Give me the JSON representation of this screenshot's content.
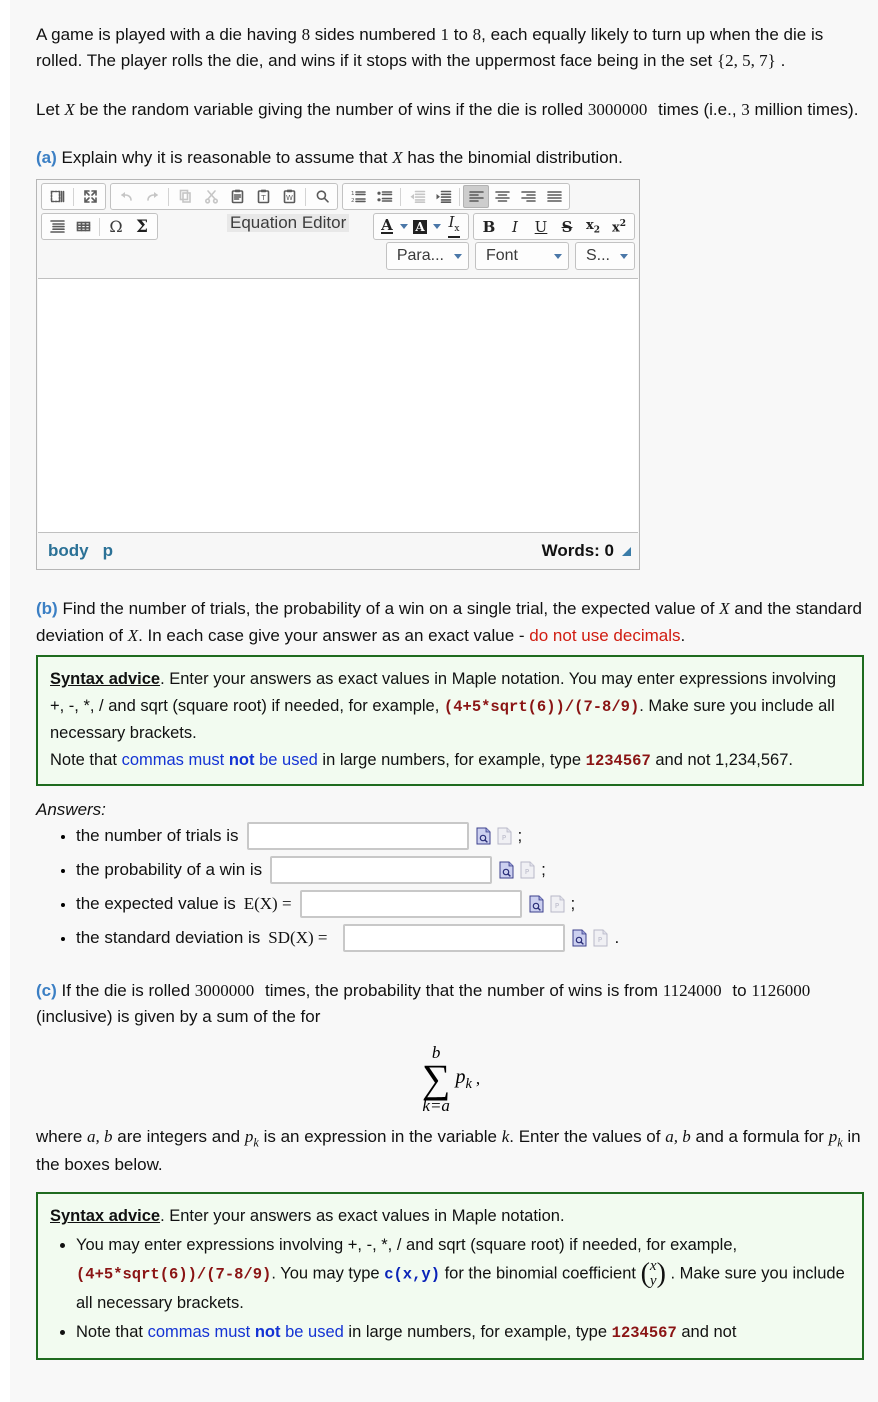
{
  "intro": {
    "p1_a": "A game is played with a die having",
    "p1_n1": "8",
    "p1_b": "sides numbered",
    "p1_n2": "1",
    "p1_c": "to",
    "p1_n3": "8",
    "p1_d": ", each equally likely to turn up when the die is rolled.  The player rolls the die, and wins if it stops with the uppermost face being in the set",
    "p1_set": "{2, 5, 7}",
    "p1_e": ".",
    "p2_a": "Let",
    "p2_x": "X",
    "p2_b": "be the random variable giving the number of wins if the die is rolled",
    "p2_n": "3000000",
    "p2_c": "times (i.e.,",
    "p2_n2": "3",
    "p2_d": "million times)."
  },
  "parts": {
    "a": {
      "label": "(a)",
      "text_a": "Explain why it is reasonable to assume that",
      "var": "X",
      "text_b": "has the binomial distribution."
    },
    "b": {
      "label": "(b)",
      "text_a": "Find the number of trials, the probability of a win on a single trial, the expected value of",
      "var": "X",
      "text_b": "and the standard deviation of",
      "var2": "X",
      "text_c": ".  In each case give your answer as an exact value -",
      "warn": "do not use decimals",
      "text_d": "."
    },
    "c": {
      "label": "(c)",
      "text_a": "If the die is rolled",
      "n_rolls": "3000000",
      "text_b": "times, the probability that the number of wins is from",
      "lo": "1124000",
      "text_c": "to",
      "hi": "1126000",
      "text_d": "(inclusive) is given by a sum of the for",
      "after_a": "where",
      "after_vars": "a, b",
      "after_b": "are integers and",
      "after_pk": "p",
      "after_pk_sub": "k",
      "after_c": "is an expression in the variable",
      "after_k": "k",
      "after_d": ".  Enter the values of",
      "after_vars2": "a, b",
      "after_e": "and a formula for",
      "after_f": "in the boxes below."
    }
  },
  "formula": {
    "upper": "b",
    "sigma": "∑",
    "lower": "k=a",
    "term": "p",
    "term_sub": "k",
    "comma": ","
  },
  "editor": {
    "tooltip": "Equation Editor",
    "toolbar_row1": [
      {
        "name": "source-icon",
        "title": "Source"
      },
      {
        "name": "maximize-icon",
        "title": "Maximize"
      },
      {
        "name": "undo-icon",
        "title": "Undo"
      },
      {
        "name": "redo-icon",
        "title": "Redo"
      },
      {
        "name": "copy-icon",
        "title": "Copy"
      },
      {
        "name": "cut-icon",
        "title": "Cut"
      },
      {
        "name": "paste-icon",
        "title": "Paste"
      },
      {
        "name": "paste-text-icon",
        "title": "Paste as plain text"
      },
      {
        "name": "paste-word-icon",
        "title": "Paste from Word"
      },
      {
        "name": "find-icon",
        "title": "Find"
      },
      {
        "name": "numbered-list-icon",
        "title": "Insert/Remove Numbered List"
      },
      {
        "name": "bulleted-list-icon",
        "title": "Insert/Remove Bulleted List"
      },
      {
        "name": "outdent-icon",
        "title": "Decrease Indent"
      },
      {
        "name": "indent-icon",
        "title": "Increase Indent"
      },
      {
        "name": "align-left-icon",
        "title": "Align Left"
      },
      {
        "name": "align-center-icon",
        "title": "Center"
      },
      {
        "name": "align-right-icon",
        "title": "Align Right"
      },
      {
        "name": "justify-icon",
        "title": "Justify"
      }
    ],
    "toolbar_row2": [
      {
        "name": "blockquote-icon",
        "title": "Block Quote"
      },
      {
        "name": "table-icon",
        "title": "Table"
      },
      {
        "name": "special-char-icon",
        "title": "Insert Special Character",
        "glyph": "Ω"
      },
      {
        "name": "equation-editor-icon",
        "title": "Equation Editor",
        "glyph": "Σ"
      },
      {
        "name": "text-color-icon",
        "title": "Text Color",
        "glyph": "A"
      },
      {
        "name": "background-color-icon",
        "title": "Background Color",
        "glyph": "A"
      },
      {
        "name": "remove-format-icon",
        "title": "Remove Format",
        "glyph": "Iₓ"
      },
      {
        "name": "bold-icon",
        "title": "Bold",
        "glyph": "B"
      },
      {
        "name": "italic-icon",
        "title": "Italic",
        "glyph": "I"
      },
      {
        "name": "underline-icon",
        "title": "Underline",
        "glyph": "U"
      },
      {
        "name": "strikethrough-icon",
        "title": "Strike Through",
        "glyph": "S"
      },
      {
        "name": "subscript-icon",
        "title": "Subscript",
        "glyph": "x₂"
      },
      {
        "name": "superscript-icon",
        "title": "Superscript",
        "glyph": "x²"
      }
    ],
    "dropdowns": [
      {
        "name": "paragraph-format-select",
        "label": "Para..."
      },
      {
        "name": "font-select",
        "label": "Font"
      },
      {
        "name": "font-size-select",
        "label": "S..."
      }
    ],
    "footer": {
      "crumb_body": "body",
      "crumb_p": "p",
      "words": "Words: 0"
    }
  },
  "advice1": {
    "title": "Syntax advice",
    "l1_a": ".  Enter your answers as exact values in Maple notation.  You may enter expressions involving +, -, *, / and sqrt (square root) if needed, for example,",
    "code1": "(4+5*sqrt(6))/(7-8/9)",
    "l1_b": ".  Make sure you include all necessary brackets.",
    "l2_a": "Note that",
    "l2_blue": "commas must",
    "l2_blue_bold": "not",
    "l2_blue2": "be used",
    "l2_b": "in large numbers, for example, type",
    "code2": "1234567",
    "l2_c": "and not 1,234,567."
  },
  "answers": {
    "heading": "Answers:",
    "items": [
      {
        "label": "the number of trials is",
        "input_width": 222,
        "value": "",
        "punct": ";",
        "math": ""
      },
      {
        "label": "the probability of a win is",
        "input_width": 222,
        "value": "",
        "punct": ";",
        "math": ""
      },
      {
        "label": "the expected value is",
        "math": "E(X) =",
        "input_width": 222,
        "value": "",
        "punct": ";"
      },
      {
        "label": "the standard deviation is",
        "math": "SD(X) =",
        "input_width": 222,
        "value": "",
        "punct": "."
      }
    ],
    "icons": [
      {
        "name": "preview-answer-icon"
      },
      {
        "name": "answer-preview-disabled-icon"
      }
    ]
  },
  "advice2": {
    "title": "Syntax advice",
    "lead": ".  Enter your answers as exact values in Maple notation.",
    "b1_a": "You may enter expressions involving +, -, *, / and sqrt (square root) if needed, for example,",
    "b1_code": "(4+5*sqrt(6))/(7-8/9)",
    "b1_b": ".  You may type",
    "b1_code2": "c(x,y)",
    "b1_c": "for the binomial coefficient",
    "b1_binom_top": "x",
    "b1_binom_bot": "y",
    "b1_d": ".  Make sure you include all necessary brackets.",
    "b2_a": "Note that",
    "b2_blue": "commas must",
    "b2_blue_bold": "not",
    "b2_blue2": "be used",
    "b2_b": "in large numbers, for example, type",
    "b2_code": "1234567",
    "b2_c": "and not"
  },
  "colors": {
    "accent_blue": "#3b7fc4",
    "warn_red": "#d01b10",
    "advice_border": "#1f6b1f",
    "advice_bg": "#f2fbf0",
    "code_red": "#8a1414",
    "link_blue": "#1433d4"
  }
}
